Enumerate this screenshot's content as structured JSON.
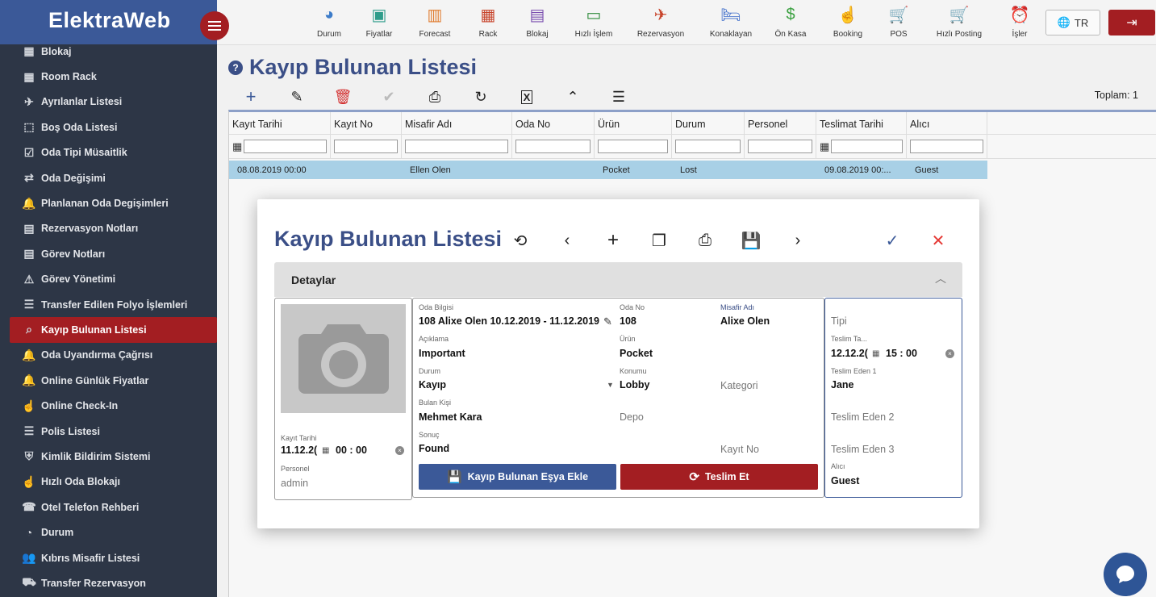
{
  "brand": {
    "name": "ElektraWeb"
  },
  "sidebar": {
    "items": [
      {
        "label": "Blokaj",
        "icon": "grid-icon"
      },
      {
        "label": "Room Rack",
        "icon": "grid-icon"
      },
      {
        "label": "Ayrılanlar Listesi",
        "icon": "plane-icon"
      },
      {
        "label": "Boş Oda Listesi",
        "icon": "dotted-square-icon"
      },
      {
        "label": "Oda Tipi Müsaitlik",
        "icon": "calendar-check-icon"
      },
      {
        "label": "Oda Değişimi",
        "icon": "swap-icon"
      },
      {
        "label": "Planlanan Oda Degişimleri",
        "icon": "bell-icon"
      },
      {
        "label": "Rezervasyon Notları",
        "icon": "note-icon"
      },
      {
        "label": "Görev Notları",
        "icon": "note-icon"
      },
      {
        "label": "Görev Yönetimi",
        "icon": "warning-icon"
      },
      {
        "label": "Transfer Edilen Folyo İşlemleri",
        "icon": "list-icon"
      },
      {
        "label": "Kayıp Bulunan Listesi",
        "icon": "search-box-icon"
      },
      {
        "label": "Oda Uyandırma Çağrısı",
        "icon": "bell-icon"
      },
      {
        "label": "Online Günlük Fiyatlar",
        "icon": "bell-icon"
      },
      {
        "label": "Online Check-In",
        "icon": "hand-icon"
      },
      {
        "label": "Polis Listesi",
        "icon": "list-icon"
      },
      {
        "label": "Kimlik Bildirim Sistemi",
        "icon": "shield-icon"
      },
      {
        "label": "Hızlı Oda Blokajı",
        "icon": "hand-icon"
      },
      {
        "label": "Otel Telefon Rehberi",
        "icon": "contact-icon"
      },
      {
        "label": "Durum",
        "icon": "pie-icon"
      },
      {
        "label": "Kıbrıs Misafir Listesi",
        "icon": "people-icon"
      },
      {
        "label": "Transfer Rezervasyon",
        "icon": "bus-icon"
      }
    ],
    "active_index": 11
  },
  "topnav": [
    {
      "label": "Durum",
      "icon": "pie-chart-icon",
      "color": "#3d7cc9"
    },
    {
      "label": "Fiyatlar",
      "icon": "price-board-icon",
      "color": "#2e9c8a"
    },
    {
      "label": "Forecast",
      "icon": "bar-chart-icon",
      "color": "#e07b2e"
    },
    {
      "label": "Rack",
      "icon": "rack-grid-icon",
      "color": "#c8452c"
    },
    {
      "label": "Blokaj",
      "icon": "calendar-icon",
      "color": "#7b4fb0"
    },
    {
      "label": "Hızlı İşlem",
      "icon": "laptop-icon",
      "color": "#2e8b3a"
    },
    {
      "label": "Rezervasyon",
      "icon": "plane-landing-icon",
      "color": "#c8452c"
    },
    {
      "label": "Konaklayan",
      "icon": "bed-icon",
      "color": "#3d6cc9"
    },
    {
      "label": "Ön Kasa",
      "icon": "dollar-icon",
      "color": "#3aa040"
    },
    {
      "label": "Booking",
      "icon": "touch-icon",
      "color": "#d0448a"
    },
    {
      "label": "POS",
      "icon": "cart-plus-icon",
      "color": "#e0533a"
    },
    {
      "label": "Hızlı Posting",
      "icon": "cart-icon",
      "color": "#9040b8"
    },
    {
      "label": "İşler",
      "icon": "alarm-icon",
      "color": "#c8452c"
    }
  ],
  "lang": {
    "code": "TR"
  },
  "page": {
    "title": "Kayıp Bulunan Listesi",
    "total": "Toplam: 1"
  },
  "grid": {
    "columns": [
      "Kayıt Tarihi",
      "Kayıt No",
      "Misafir Adı",
      "Oda No",
      "Ürün",
      "Durum",
      "Personel",
      "Teslimat Tarihi",
      "Alıcı"
    ],
    "rows": [
      [
        "08.08.2019 00:00",
        "",
        "Ellen Olen",
        "",
        "Pocket",
        "Lost",
        "",
        "09.08.2019 00:...",
        "Guest"
      ]
    ]
  },
  "modal": {
    "title": "Kayıp Bulunan Listesi",
    "panel_title": "Detaylar",
    "photo": {
      "kayit_tarihi_label": "Kayıt Tarihi",
      "kayit_tarihi_date": "11.12.2(",
      "kayit_tarihi_time": "00 : 00",
      "personel_label": "Personel",
      "personel_value": "admin"
    },
    "fields": {
      "oda_bilgisi_label": "Oda Bilgisi",
      "oda_bilgisi": "108 Alixe Olen 10.12.2019 - 11.12.2019",
      "oda_no_label": "Oda No",
      "oda_no": "108",
      "misafir_adi_label": "Misafir Adı",
      "misafir_adi": "Alixe Olen",
      "aciklama_label": "Açıklama",
      "aciklama": "Important",
      "urun_label": "Ürün",
      "urun": "Pocket",
      "durum_label": "Durum",
      "durum": "Kayıp",
      "konumu_label": "Konumu",
      "konumu": "Lobby",
      "kategori_placeholder": "Kategori",
      "bulan_kisi_label": "Bulan Kişi",
      "bulan_kisi": "Mehmet Kara",
      "depo_placeholder": "Depo",
      "sonuc_label": "Sonuç",
      "sonuc": "Found",
      "kayit_no_placeholder": "Kayıt No"
    },
    "right": {
      "tipi_placeholder": "Tipi",
      "teslim_tarihi_label": "Teslim Ta...",
      "teslim_tarihi_date": "12.12.2(",
      "teslim_tarihi_time": "15 : 00",
      "teslim_eden1_label": "Teslim Eden 1",
      "teslim_eden1": "Jane",
      "teslim_eden2_placeholder": "Teslim Eden 2",
      "teslim_eden3_placeholder": "Teslim Eden 3",
      "alici_label": "Alıcı",
      "alici": "Guest"
    },
    "buttons": {
      "add": "Kayıp Bulunan Eşya Ekle",
      "deliver": "Teslim Et"
    }
  }
}
